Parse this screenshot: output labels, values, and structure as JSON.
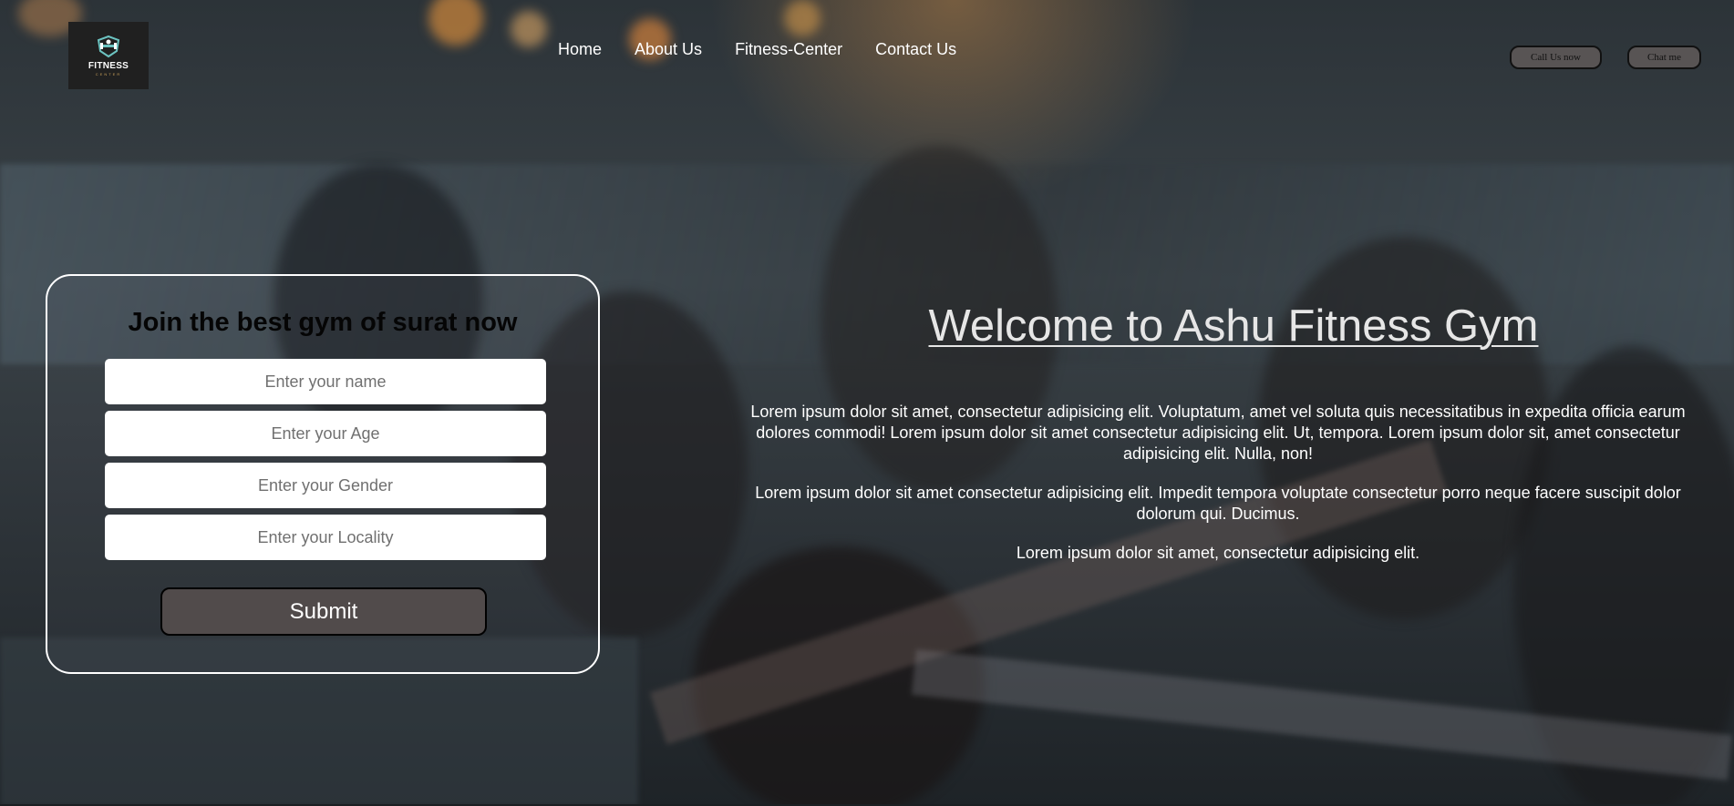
{
  "header": {
    "logo": {
      "title": "FITNESS",
      "subtitle": "CENTER"
    },
    "nav": [
      "Home",
      "About Us",
      "Fitness-Center",
      "Contact Us"
    ],
    "actions": {
      "call": "Call Us now",
      "chat": "Chat me"
    }
  },
  "form": {
    "heading": "Join the best gym of surat now",
    "fields": [
      {
        "placeholder": "Enter your name",
        "value": ""
      },
      {
        "placeholder": "Enter your Age",
        "value": ""
      },
      {
        "placeholder": "Enter your Gender",
        "value": ""
      },
      {
        "placeholder": "Enter your Locality",
        "value": ""
      }
    ],
    "submit_label": "Submit"
  },
  "hero": {
    "title": "Welcome to Ashu Fitness Gym",
    "paragraphs": [
      "Lorem ipsum dolor sit amet, consectetur adipisicing elit. Voluptatum, amet vel soluta quis necessitatibus in expedita officia earum dolores commodi! Lorem ipsum dolor sit amet consectetur adipisicing elit. Ut, tempora. Lorem ipsum dolor sit, amet consectetur adipisicing elit. Nulla, non!",
      "Lorem ipsum dolor sit amet consectetur adipisicing elit. Impedit tempora voluptate consectetur porro neque facere suscipit dolor dolorum qui. Ducimus.",
      "Lorem ipsum dolor sit amet, consectetur adipisicing elit."
    ]
  },
  "background": {
    "description_icon": "gym-dumbbell-rack-photo"
  },
  "colors": {
    "button": "#514b4b",
    "pill": "#585454",
    "card_border": "#ffffff",
    "title": "#e6e6e6"
  }
}
